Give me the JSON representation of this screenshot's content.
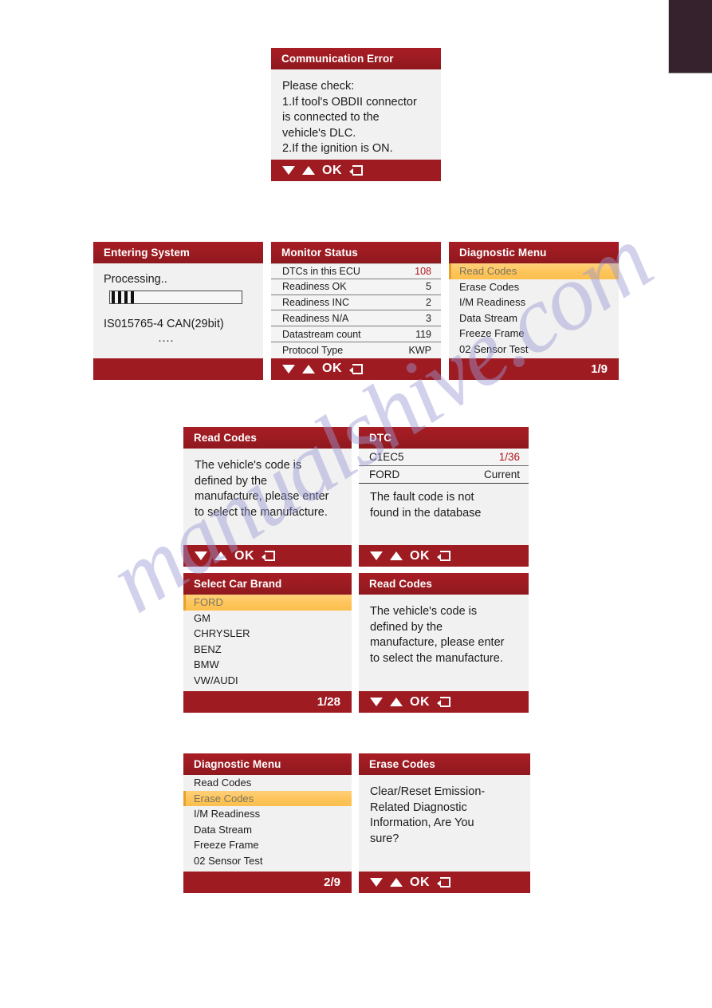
{
  "watermark": {
    "text": "manualshive.com"
  },
  "nav": {
    "ok_label": "OK",
    "down_icon": "triangle-down-icon",
    "up_icon": "triangle-up-icon",
    "return_icon": "return-arrow-icon"
  },
  "panels": {
    "communication_error": {
      "title": "Communication Error",
      "lines": [
        "Please check:",
        "1.If tool's OBDII connector",
        "is connected to the",
        "vehicle's DLC.",
        "2.If the ignition is ON."
      ]
    },
    "entering_system": {
      "title": "Entering System",
      "processing": "Processing..",
      "progress_segments": 4,
      "protocol": "IS015765-4 CAN(29bit)",
      "dots": "...."
    },
    "monitor_status": {
      "title": "Monitor Status",
      "rows": [
        {
          "label": "DTCs in this ECU",
          "value": "108",
          "alert": true
        },
        {
          "label": "Readiness OK",
          "value": "5",
          "alert": false
        },
        {
          "label": "Readiness INC",
          "value": "2",
          "alert": false
        },
        {
          "label": "Readiness N/A",
          "value": "3",
          "alert": false
        },
        {
          "label": "Datastream count",
          "value": "119",
          "alert": false
        },
        {
          "label": "Protocol Type",
          "value": "KWP",
          "alert": false
        }
      ]
    },
    "diagnostic_menu_1": {
      "title": "Diagnostic Menu",
      "items": [
        "Read Codes",
        "Erase Codes",
        "I/M Readiness",
        "Data Stream",
        "Freeze Frame",
        "02 Sensor Test"
      ],
      "selected_index": 0,
      "page": "1/9"
    },
    "read_codes_a": {
      "title": "Read Codes",
      "lines": [
        "The vehicle's code is",
        "defined by the",
        "manufacture, please enter",
        "to select the manufacture."
      ]
    },
    "dtc": {
      "title": "DTC",
      "code": "C1EC5",
      "index": "1/36",
      "brand": "FORD",
      "state": "Current",
      "lines": [
        "The fault code is not",
        "found in the database"
      ]
    },
    "select_car_brand": {
      "title": "Select Car Brand",
      "items": [
        "FORD",
        "GM",
        "CHRYSLER",
        "BENZ",
        "BMW",
        "VW/AUDI"
      ],
      "selected_index": 0,
      "page": "1/28"
    },
    "read_codes_b": {
      "title": "Read Codes",
      "lines": [
        "The vehicle's code is",
        "defined by the",
        "manufacture, please enter",
        "to select the manufacture."
      ]
    },
    "diagnostic_menu_2": {
      "title": "Diagnostic Menu",
      "items": [
        "Read Codes",
        "Erase Codes",
        "I/M Readiness",
        "Data Stream",
        "Freeze Frame",
        "02 Sensor Test"
      ],
      "selected_index": 1,
      "page": "2/9"
    },
    "erase_codes": {
      "title": "Erase Codes",
      "lines": [
        "Clear/Reset Emission-",
        "Related Diagnostic",
        "Information, Are You",
        "sure?"
      ]
    }
  },
  "colors": {
    "header_red": "#9e1b22",
    "highlight_amber": "#fec55c",
    "alert_red": "#b3141c",
    "screen_bg": "#f1f1f1",
    "corner_block": "#35222c"
  }
}
